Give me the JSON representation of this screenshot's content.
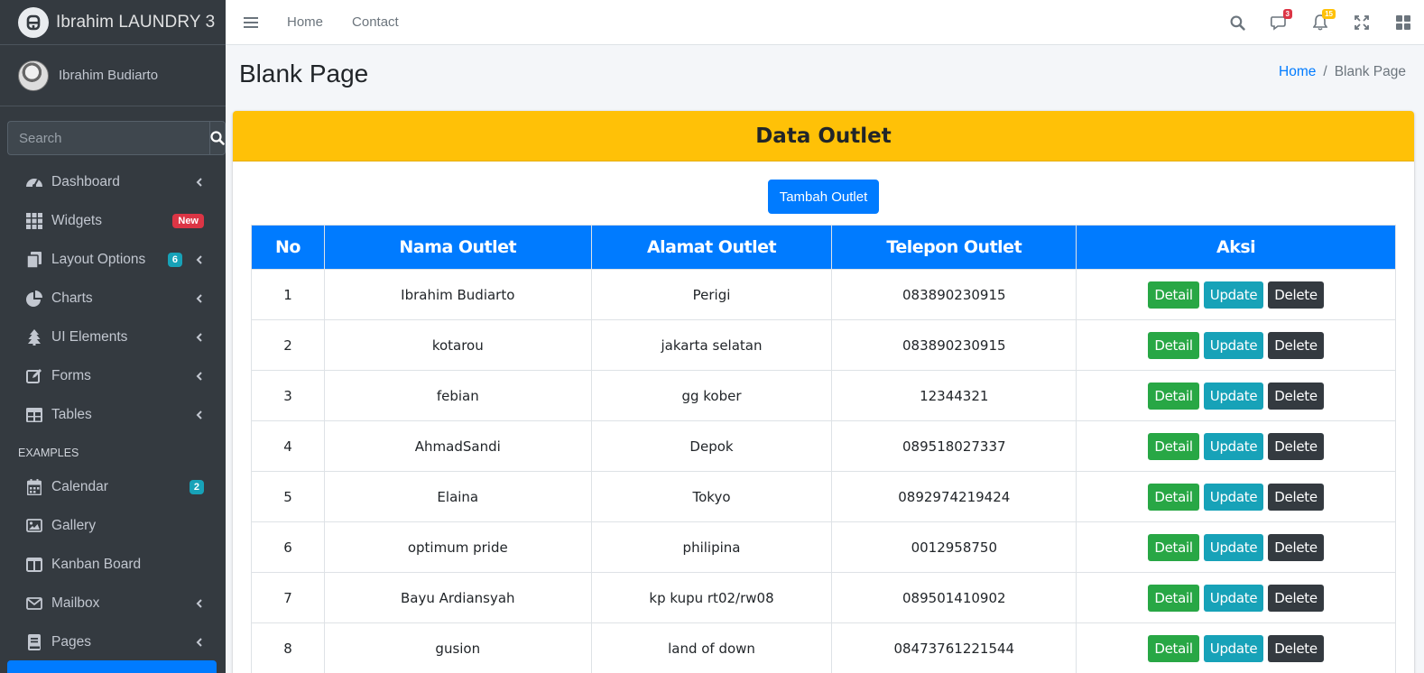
{
  "brand": {
    "title": "Ibrahim LAUNDRY 3"
  },
  "user": {
    "name": "Ibrahim Budiarto"
  },
  "sidebar_search": {
    "placeholder": "Search"
  },
  "sidebar": {
    "items": [
      {
        "label": "Dashboard",
        "icon": "tachometer-icon"
      },
      {
        "label": "Widgets",
        "icon": "grid-icon",
        "badge": "New"
      },
      {
        "label": "Layout Options",
        "icon": "copy-icon",
        "badge": "6"
      },
      {
        "label": "Charts",
        "icon": "pie-chart-icon"
      },
      {
        "label": "UI Elements",
        "icon": "tree-icon"
      },
      {
        "label": "Forms",
        "icon": "edit-icon"
      },
      {
        "label": "Tables",
        "icon": "table-icon"
      }
    ],
    "header": "EXAMPLES",
    "examples": [
      {
        "label": "Calendar",
        "icon": "calendar-icon",
        "badge": "2"
      },
      {
        "label": "Gallery",
        "icon": "image-icon"
      },
      {
        "label": "Kanban Board",
        "icon": "columns-icon"
      },
      {
        "label": "Mailbox",
        "icon": "envelope-icon"
      },
      {
        "label": "Pages",
        "icon": "book-icon"
      }
    ]
  },
  "topnav": {
    "links": [
      "Home",
      "Contact"
    ],
    "messages_badge": "3",
    "notifications_badge": "15"
  },
  "page": {
    "title": "Blank Page",
    "breadcrumb": {
      "home": "Home",
      "separator": "/",
      "current": "Blank Page"
    }
  },
  "card": {
    "title": "Data Outlet",
    "add_button": "Tambah Outlet",
    "columns": [
      "No",
      "Nama Outlet",
      "Alamat Outlet",
      "Telepon Outlet",
      "Aksi"
    ],
    "rows": [
      {
        "no": "1",
        "nama": "Ibrahim Budiarto",
        "alamat": "Perigi",
        "telepon": "083890230915"
      },
      {
        "no": "2",
        "nama": "kotarou",
        "alamat": "jakarta selatan",
        "telepon": "083890230915"
      },
      {
        "no": "3",
        "nama": "febian",
        "alamat": "gg kober",
        "telepon": "12344321"
      },
      {
        "no": "4",
        "nama": "AhmadSandi",
        "alamat": "Depok",
        "telepon": "089518027337"
      },
      {
        "no": "5",
        "nama": "Elaina",
        "alamat": "Tokyo",
        "telepon": "0892974219424"
      },
      {
        "no": "6",
        "nama": "optimum pride",
        "alamat": "philipina",
        "telepon": "0012958750"
      },
      {
        "no": "7",
        "nama": "Bayu Ardiansyah",
        "alamat": "kp kupu rt02/rw08",
        "telepon": "089501410902"
      },
      {
        "no": "8",
        "nama": "gusion",
        "alamat": "land of down",
        "telepon": "08473761221544"
      }
    ],
    "actions": {
      "detail": "Detail",
      "update": "Update",
      "delete": "Delete"
    }
  },
  "colors": {
    "sidebar_bg": "#343a40",
    "primary": "#007bff",
    "warning": "#ffc107",
    "success": "#28a745",
    "info": "#17a2b8",
    "dark": "#343a40",
    "danger": "#dc3545"
  }
}
